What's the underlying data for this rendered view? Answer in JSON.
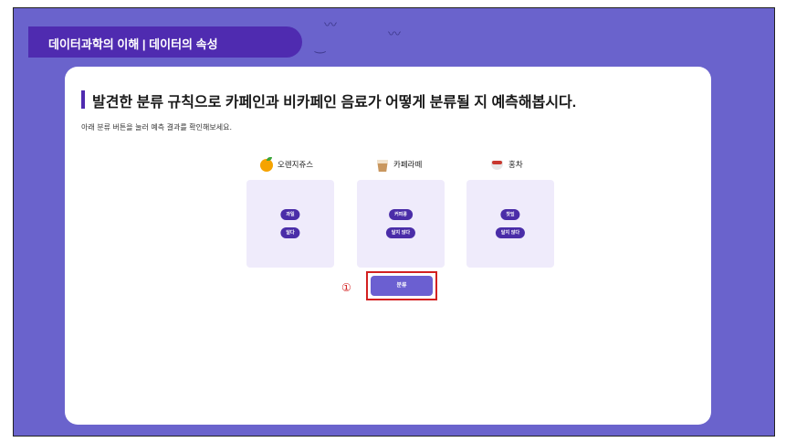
{
  "header": {
    "title": "데이터과학의 이해  |  데이터의 속성"
  },
  "main": {
    "title": "발견한 분류 규칙으로 카페인과 비카페인 음료가 어떻게 분류될 지 예측해봅시다.",
    "subtitle": "아래 분류 버튼을 눌러 예측 결과를 확인해보세요."
  },
  "drinks": [
    {
      "label": "오렌지쥬스",
      "icon": "orange-icon",
      "tags": [
        "과일",
        "달다"
      ]
    },
    {
      "label": "카페라떼",
      "icon": "latte-icon",
      "tags": [
        "커피콩",
        "달지 않다"
      ]
    },
    {
      "label": "홍차",
      "icon": "tea-icon",
      "tags": [
        "찻잎",
        "달지 않다"
      ]
    }
  ],
  "marker": "①",
  "classify_button": {
    "label": "분류"
  },
  "colors": {
    "background": "#6a63cc",
    "accent": "#4f2bb0",
    "pill": "#4a2da8",
    "highlight": "#d32020"
  }
}
